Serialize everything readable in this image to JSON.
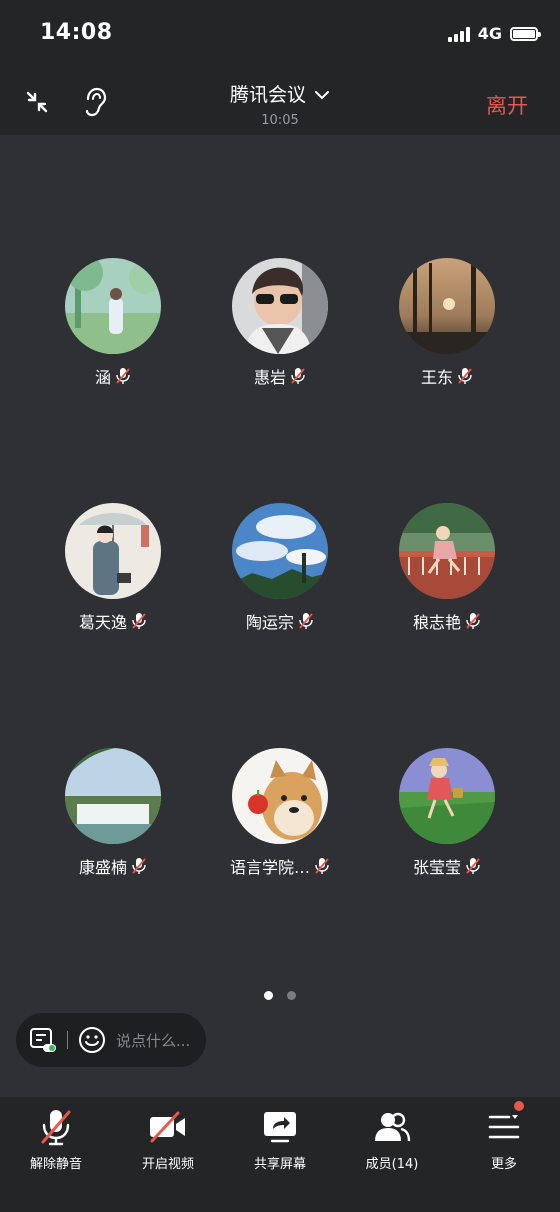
{
  "status_bar": {
    "time": "14:08",
    "network": "4G"
  },
  "header": {
    "title": "腾讯会议",
    "meeting_time": "10:05",
    "leave_label": "离开"
  },
  "members": [
    {
      "name": "涵",
      "avatar": "girl-in-meadow"
    },
    {
      "name": "惠岩",
      "avatar": "woman-with-sunglasses"
    },
    {
      "name": "王东",
      "avatar": "sunset-silhouette"
    },
    {
      "name": "葛天逸",
      "avatar": "painted-woman-with-umbrella"
    },
    {
      "name": "陶运宗",
      "avatar": "blue-sky-clouds"
    },
    {
      "name": "稂志艳",
      "avatar": "anime-girl-on-bridge"
    },
    {
      "name": "康盛楠",
      "avatar": "waterfall-landscape"
    },
    {
      "name": "语言学院…",
      "avatar": "shiba-dog-with-apple"
    },
    {
      "name": "张莹莹",
      "avatar": "anime-girl-in-field"
    }
  ],
  "pagination": {
    "current": 1,
    "total": 2
  },
  "chat": {
    "placeholder": "说点什么..."
  },
  "toolbar": {
    "unmute": "解除静音",
    "video": "开启视频",
    "share": "共享屏幕",
    "members": "成员(14)",
    "more": "更多"
  },
  "colors": {
    "accent_red": "#e8574d",
    "background": "#2e3033",
    "bar": "#232527"
  }
}
